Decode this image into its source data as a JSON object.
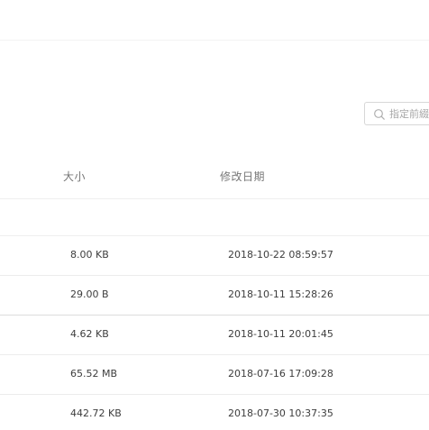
{
  "search": {
    "placeholder": "指定前綴"
  },
  "table": {
    "headers": {
      "size": "大小",
      "modified": "修改日期"
    },
    "rows": [
      {
        "size": "8.00 KB",
        "modified": "2018-10-22 08:59:57"
      },
      {
        "size": "29.00 B",
        "modified": "2018-10-11 15:28:26"
      },
      {
        "size": "4.62 KB",
        "modified": "2018-10-11 20:01:45"
      },
      {
        "size": "65.52 MB",
        "modified": "2018-07-16 17:09:28"
      },
      {
        "size": "442.72 KB",
        "modified": "2018-07-30 10:37:35"
      }
    ]
  },
  "colors": {
    "border": "#d7d7d7",
    "text": "#3d3d3d",
    "header_text": "#777777"
  }
}
